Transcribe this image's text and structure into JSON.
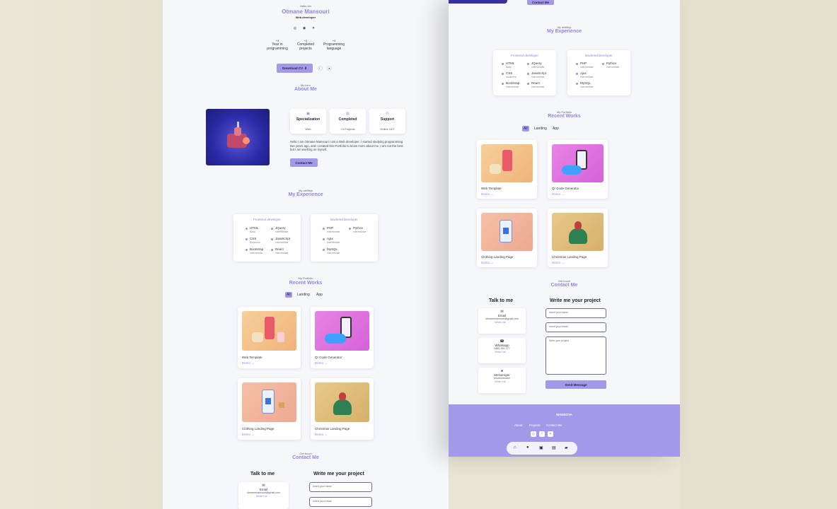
{
  "hero": {
    "greeting": "Hello I'm",
    "name": "Otmane Mansouri",
    "role": "Web developer",
    "social_icons": [
      "instagram-icon",
      "github-icon",
      "twitter-icon"
    ],
    "stats": [
      {
        "num": "+3",
        "label": "Year in programming"
      },
      {
        "num": "+3",
        "label": "Completed projects"
      },
      {
        "num": "+3",
        "label": "Programming language"
      }
    ],
    "download_label": "Download CV",
    "download_icon": "⬇"
  },
  "about": {
    "subtitle": "My intro",
    "title": "About Me",
    "cards": [
      {
        "icon": "▣",
        "title": "Specialization",
        "value": "Web"
      },
      {
        "icon": "▤",
        "title": "Completed",
        "value": "+4 Projects"
      },
      {
        "icon": "☊",
        "title": "Support",
        "value": "Online 24/7"
      }
    ],
    "text": "Hello I am Otmane Mansouri I am a Web developer, I started studying programming two years ago, and I created this Portfolio to know more about me ,I am not the best but I am working on myself.",
    "contact_button": "Contact Me"
  },
  "experience": {
    "subtitle": "My abilities",
    "title": "My Experience",
    "frontend": {
      "title": "Frontend developer",
      "skills": [
        {
          "name": "HTML",
          "level": "Basic"
        },
        {
          "name": "JQuery",
          "level": "Intermediate"
        },
        {
          "name": "CSS",
          "level": "Advanced"
        },
        {
          "name": "JavaScript",
          "level": "Intermediate"
        },
        {
          "name": "Bootstrap",
          "level": "Intermediate"
        },
        {
          "name": "React",
          "level": "Intermediate"
        }
      ]
    },
    "backend": {
      "title": "Backend developer",
      "skills": [
        {
          "name": "PHP",
          "level": "Intermediate"
        },
        {
          "name": "Python",
          "level": "Intermediate"
        },
        {
          "name": "Ajax",
          "level": "Intermediate"
        },
        {
          "name": "MySQL",
          "level": "Intermediate"
        }
      ]
    }
  },
  "works": {
    "subtitle": "My Portfolio",
    "title": "Recent Works",
    "tabs": [
      "All",
      "Landing",
      "App"
    ],
    "items": [
      {
        "title": "Web Template",
        "demo": "Demo →"
      },
      {
        "title": "Qr Code Generator",
        "demo": "Demo →"
      },
      {
        "title": "Clothing Landing Page",
        "demo": "Demo →"
      },
      {
        "title": "Christmas Landing Page",
        "demo": "Demo →"
      }
    ]
  },
  "contact": {
    "subtitle": "Get touch",
    "title": "Contact Me",
    "talk_title": "Talk to me",
    "write_title": "Write me your project",
    "methods": [
      {
        "icon": "✉",
        "title": "Email",
        "value": "otmanemansouri@gmail.com",
        "write": "Write me →"
      },
      {
        "icon": "☎",
        "title": "Whatsapp",
        "value": "0680-991-377",
        "write": "Write me →"
      },
      {
        "icon": "●",
        "title": "Messenger",
        "value": "pruebcotmane",
        "write": "Write me →"
      }
    ],
    "name_placeholder": "Insert your name",
    "email_placeholder": "Insert your email",
    "project_placeholder": "Write your project",
    "send_label": "Send Message"
  },
  "footer": {
    "brand": "MANSOYA",
    "links": [
      "About",
      "Projects",
      "Contact Me"
    ],
    "social_icons": [
      "instagram-icon",
      "facebook-icon",
      "twitter-icon"
    ],
    "nav_icons": [
      "home-icon",
      "user-icon",
      "briefcase-icon",
      "image-icon",
      "message-icon"
    ]
  },
  "colors": {
    "accent": "#a498e8",
    "accent_text": "#9284e6",
    "panel_bg": "#f6f7fb",
    "page_bg": "#e9e5d6"
  }
}
